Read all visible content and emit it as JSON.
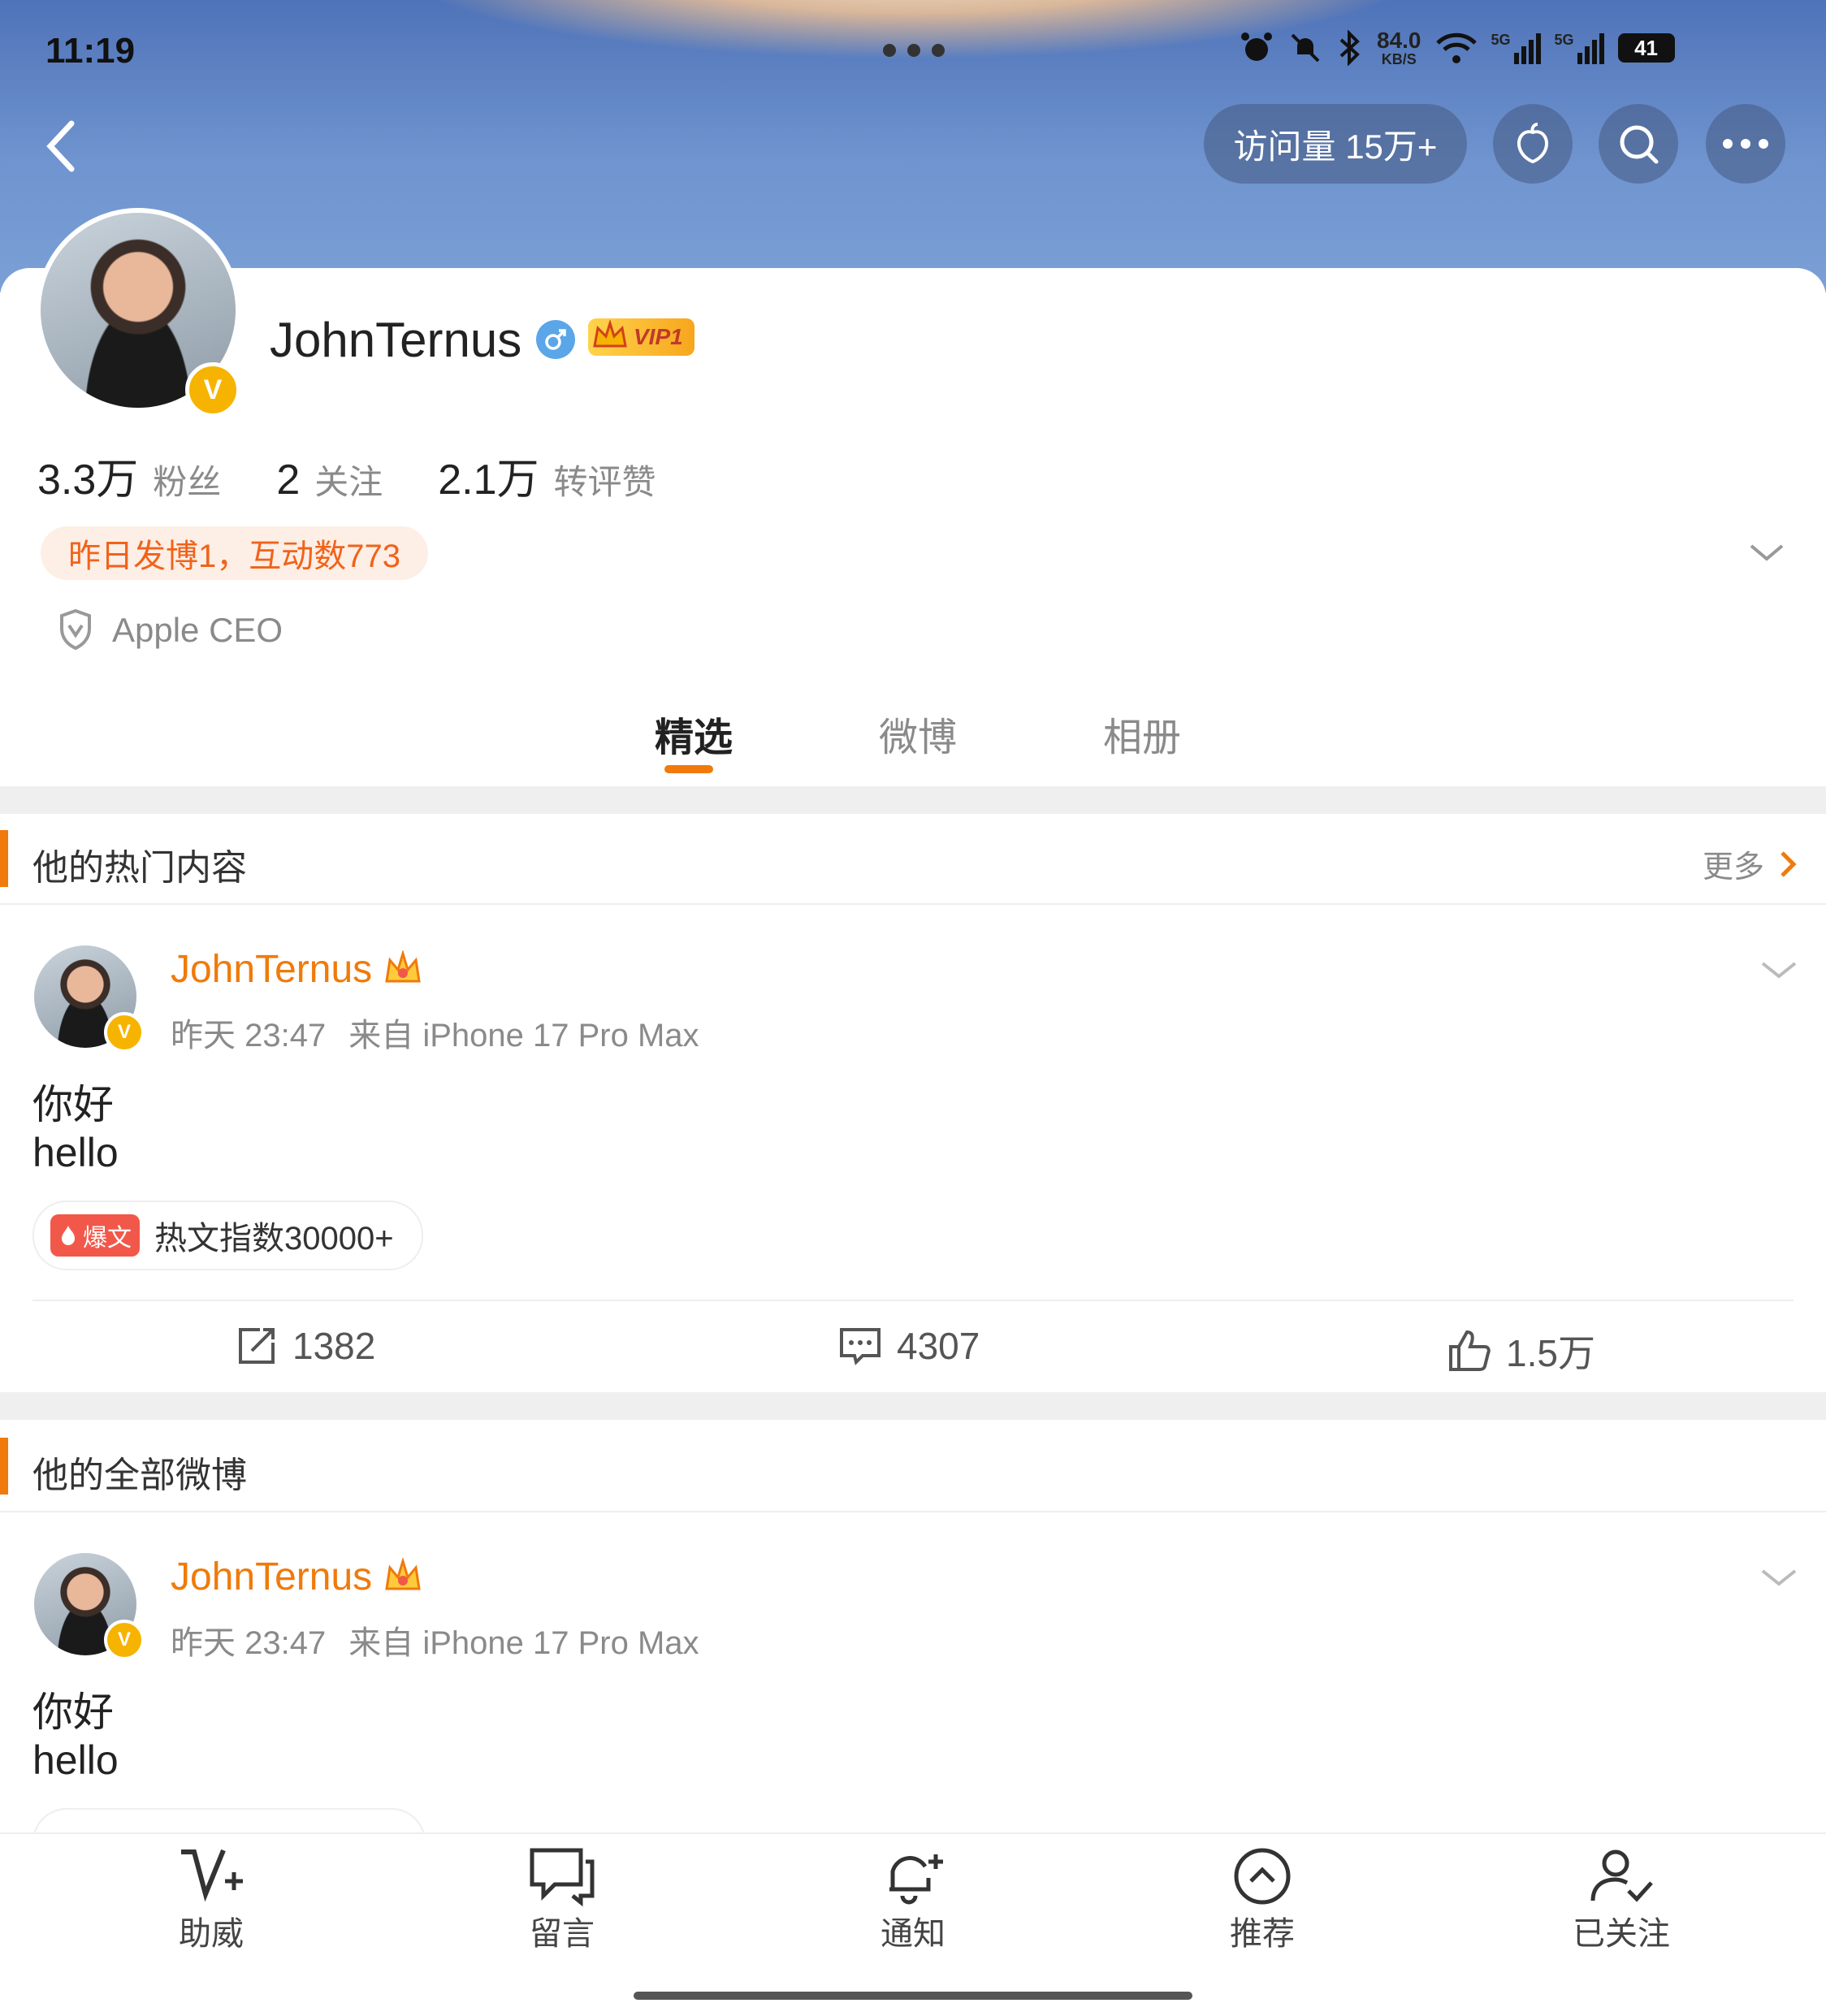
{
  "status_bar": {
    "time": "11:19",
    "net_speed_value": "84.0",
    "net_speed_unit": "KB/S",
    "battery": "41",
    "signal1": "5G",
    "signal2": "5G"
  },
  "header": {
    "visits": "访问量 15万+"
  },
  "profile": {
    "name": "JohnTernus",
    "vip": "VIP1",
    "verified_badge": "V",
    "stats": [
      {
        "value": "3.3万",
        "label": "粉丝"
      },
      {
        "value": "2",
        "label": "关注"
      },
      {
        "value": "2.1万",
        "label": "转评赞"
      }
    ],
    "activity": "昨日发博1，互动数773",
    "verification": "Apple CEO"
  },
  "tabs": [
    {
      "label": "精选",
      "active": true
    },
    {
      "label": "微博",
      "active": false
    },
    {
      "label": "相册",
      "active": false
    }
  ],
  "hot_section": {
    "title": "他的热门内容",
    "more": "更多",
    "post": {
      "author": "JohnTernus",
      "time": "昨天 23:47",
      "source": "来自 iPhone 17 Pro Max",
      "line1": "你好",
      "line2": "hello",
      "badge": "爆文",
      "hot_index": "热文指数30000+",
      "reposts": "1382",
      "comments": "4307",
      "likes": "1.5万"
    }
  },
  "all_section": {
    "title": "他的全部微博",
    "post": {
      "author": "JohnTernus",
      "time": "昨天 23:47",
      "source": "来自 iPhone 17 Pro Max",
      "line1": "你好",
      "line2": "hello"
    }
  },
  "bottom_nav": [
    {
      "label": "助威",
      "icon": "cheer-icon"
    },
    {
      "label": "留言",
      "icon": "message-icon"
    },
    {
      "label": "通知",
      "icon": "bell-icon"
    },
    {
      "label": "推荐",
      "icon": "recommend-icon"
    },
    {
      "label": "已关注",
      "icon": "followed-icon"
    }
  ],
  "colors": {
    "accent": "#f07a0b",
    "badge_yellow": "#f6b400",
    "hot_red": "#f2584a"
  }
}
